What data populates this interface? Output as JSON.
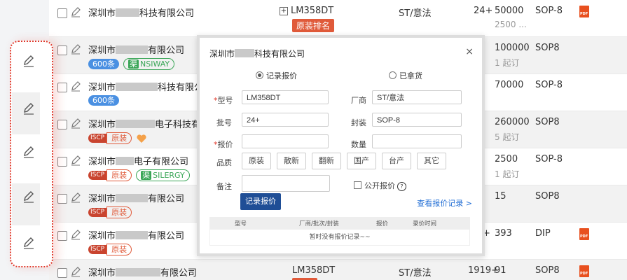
{
  "rows": [
    {
      "company_prefix": "深圳市",
      "company_suffix": "科技有限公司",
      "model": "LM358DT",
      "rank_badge": "原装排名",
      "maker": "ST/意法",
      "batch": "24+",
      "qty": "50000",
      "qty_sub": "2500 ...",
      "pkg": "SOP-8"
    },
    {
      "company_prefix": "深圳市",
      "company_suffix": "有限公司",
      "badge_count": "600条",
      "badge_brand_k": "渠",
      "badge_brand": "NSIWAY",
      "qty": "100000",
      "qty_sub": "1 起订",
      "pkg": "SOP8"
    },
    {
      "company_prefix": "深圳市",
      "company_suffix": "科技有限公",
      "badge_count": "600条",
      "qty": "70000",
      "pkg": "SOP-8"
    },
    {
      "company_prefix": "深圳市",
      "company_suffix": "电子科技有限",
      "iscp": "ISCP",
      "badge_orig": "原装",
      "qty": "260000",
      "qty_sub": "5 起订",
      "pkg": "SOP8"
    },
    {
      "company_prefix": "深圳市",
      "company_suffix": "电子有限公司",
      "iscp": "ISCP",
      "badge_orig": "原装",
      "badge_brand_k": "渠",
      "badge_brand": "SILERGY",
      "qty": "2500",
      "qty_sub": "1 起订",
      "pkg": "SOP-8"
    },
    {
      "company_prefix": "深圳市",
      "company_suffix": "有限公司",
      "iscp": "ISCP",
      "badge_orig": "原装",
      "qty": "15",
      "pkg": "SOP8"
    },
    {
      "company_prefix": "深圳市",
      "company_suffix": "有限公司",
      "iscp": "ISCP",
      "badge_orig": "原装",
      "qty_prefix": "+",
      "qty": "393",
      "pkg": "DIP"
    },
    {
      "company_prefix": "深圳市",
      "company_suffix": "有限公司",
      "model": "LM358DT",
      "rank_badge": "原装",
      "maker": "ST/意法",
      "batch": "1919+",
      "qty": "91",
      "pkg": "SOP8"
    }
  ],
  "modal": {
    "title_prefix": "深圳市",
    "title_suffix": "科技有限公司",
    "close": "×",
    "radio_record": "记录报价",
    "radio_got": "已拿货",
    "label_model": "型号",
    "value_model": "LM358DT",
    "label_maker": "厂商",
    "value_maker": "ST/意法",
    "label_batch": "批号",
    "value_batch": "24+",
    "label_pkg": "封装",
    "value_pkg": "SOP-8",
    "label_price": "报价",
    "value_price": "",
    "label_qty": "数量",
    "value_qty": "",
    "label_quality": "品质",
    "quality_options": [
      "原装",
      "散新",
      "翻新",
      "国产",
      "台产",
      "其它"
    ],
    "label_note": "备注",
    "value_note": "",
    "public_label": "公开报价",
    "help_glyph": "?",
    "submit": "记录报价",
    "history_link": "查看报价记录 >",
    "table_headers": [
      "型号",
      "厂商/批次/封装",
      "报价",
      "录价时间"
    ],
    "table_empty": "暂时没有报价记录~~"
  },
  "colors": {
    "accent": "#1f4e96",
    "red": "#e05a3a",
    "green": "#3aa657",
    "blue": "#4a90e2",
    "link": "#1f6cd4"
  },
  "icons": {
    "edit": "pencil-icon",
    "pdf": "pdf-icon",
    "close": "close-icon"
  }
}
